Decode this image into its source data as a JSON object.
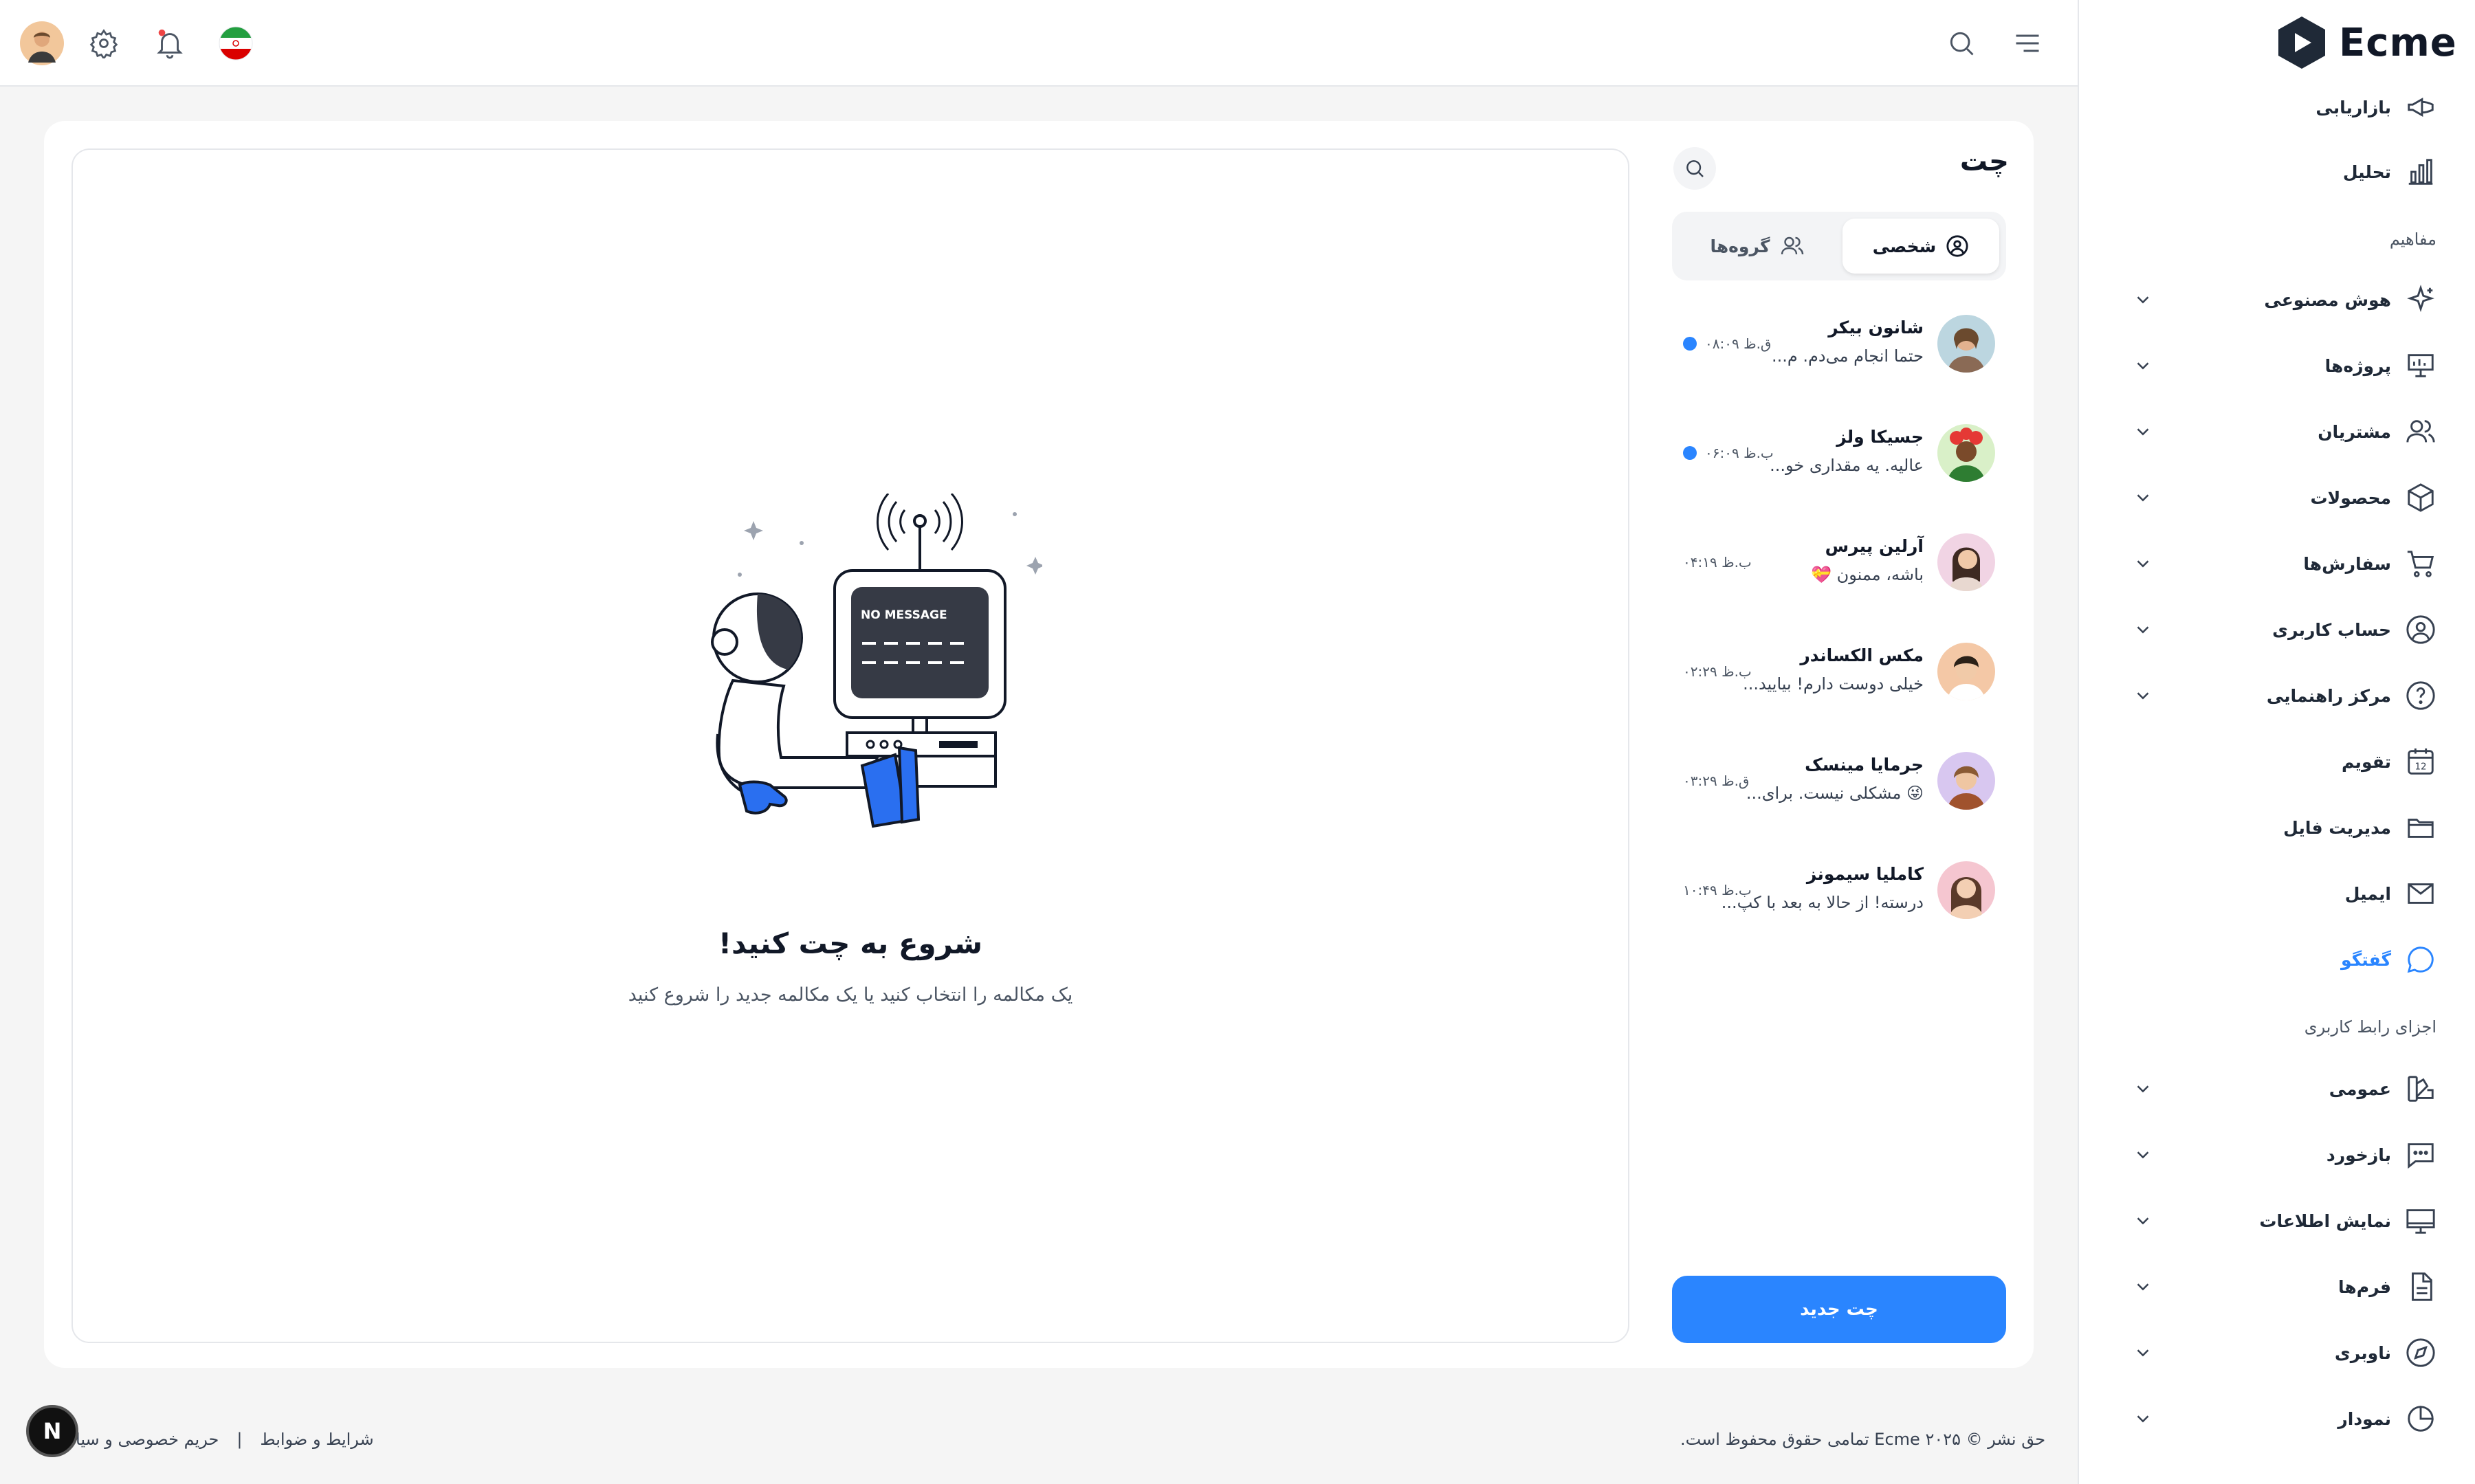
{
  "brand": {
    "name": "Ecme"
  },
  "sidebar": {
    "items": [
      {
        "label": "بازاریابی",
        "icon": "megaphone-icon",
        "chevron": false
      },
      {
        "label": "تحلیل",
        "icon": "bar-chart-icon",
        "chevron": false
      },
      {
        "label": "هوش مصنوعی",
        "icon": "sparkles-icon",
        "chevron": true
      },
      {
        "label": "پروژه‌ها",
        "icon": "presentation-icon",
        "chevron": true
      },
      {
        "label": "مشتریان",
        "icon": "users-icon",
        "chevron": true
      },
      {
        "label": "محصولات",
        "icon": "box-icon",
        "chevron": true
      },
      {
        "label": "سفارش‌ها",
        "icon": "cart-icon",
        "chevron": true
      },
      {
        "label": "حساب کاربری",
        "icon": "user-circle-icon",
        "chevron": true
      },
      {
        "label": "مرکز راهنمایی",
        "icon": "help-circle-icon",
        "chevron": true
      },
      {
        "label": "تقویم",
        "icon": "calendar-icon",
        "chevron": false
      },
      {
        "label": "مدیریت فایل",
        "icon": "folder-icon",
        "chevron": false
      },
      {
        "label": "ایمیل",
        "icon": "mail-icon",
        "chevron": false
      },
      {
        "label": "گفتگو",
        "icon": "chat-bubble-icon",
        "chevron": false,
        "active": true
      },
      {
        "label": "عمومی",
        "icon": "swatch-icon",
        "chevron": true
      },
      {
        "label": "بازخورد",
        "icon": "message-dots-icon",
        "chevron": true
      },
      {
        "label": "نمایش اطلاعات",
        "icon": "monitor-icon",
        "chevron": true
      },
      {
        "label": "فرم‌ها",
        "icon": "file-text-icon",
        "chevron": true
      },
      {
        "label": "ناوبری",
        "icon": "compass-icon",
        "chevron": true
      },
      {
        "label": "نمودار",
        "icon": "pie-chart-icon",
        "chevron": true
      }
    ],
    "sections": {
      "concepts": "مفاهیم",
      "ui_components": "اجزای رابط کاربری"
    }
  },
  "header": {
    "icons": [
      "menu-icon",
      "search-icon",
      "iran-flag-icon",
      "bell-icon",
      "gear-icon",
      "user-avatar"
    ]
  },
  "chat": {
    "title": "چت",
    "tabs": {
      "personal": "شخصی",
      "groups": "گروه‌ها"
    },
    "conversations": [
      {
        "name": "شانون بیکر",
        "message": "حتما انجام می‌دم. م...",
        "time": "۰۸:۰۹ ق.ظ",
        "unread": true,
        "avatar_color": "#bcd6e0"
      },
      {
        "name": "جسیکا ولز",
        "message": "عالیه. یه مقداری خو...",
        "time": "۰۶:۰۹ ب.ظ",
        "unread": true,
        "avatar_color": "#d9f0c8"
      },
      {
        "name": "آرلین پیرس",
        "message": "باشه، ممنون 💝",
        "time": "۰۴:۱۹ ب.ظ",
        "unread": false,
        "avatar_color": "#f1d4e4"
      },
      {
        "name": "مکس الکساندر",
        "message": "خیلی دوست دارم! بیایید...",
        "time": "۰۲:۲۹ ب.ظ",
        "unread": false,
        "avatar_color": "#f4c8a6"
      },
      {
        "name": "جرمایا مینسک",
        "message": "😜 مشکلی نیست. برای...",
        "time": "۰۳:۲۹ ق.ظ",
        "unread": false,
        "avatar_color": "#d8c7f0"
      },
      {
        "name": "کاملیا سیمونز",
        "message": "درسته! از حالا به بعد با کپ...",
        "time": "۱۰:۴۹ ب.ظ",
        "unread": false,
        "avatar_color": "#f5c6d0"
      }
    ],
    "new_chat_label": "چت جدید",
    "empty": {
      "illustration_text": "NO MESSAGE",
      "title": "شروع به چت کنید!",
      "subtitle": "یک مکالمه را انتخاب کنید یا یک مکالمه جدید را شروع کنید"
    }
  },
  "footer": {
    "copyright": "حق نشر © ۲۰۲۵ Ecme تمامی حقوق محفوظ است.",
    "terms": "شرایط و ضوابط",
    "separator": "|",
    "privacy": "حریم خصوصی و سیا"
  },
  "dev_badge": "N",
  "colors": {
    "accent": "#2a85ff",
    "background": "#f5f5f5",
    "card": "#ffffff",
    "text": "#111827"
  }
}
